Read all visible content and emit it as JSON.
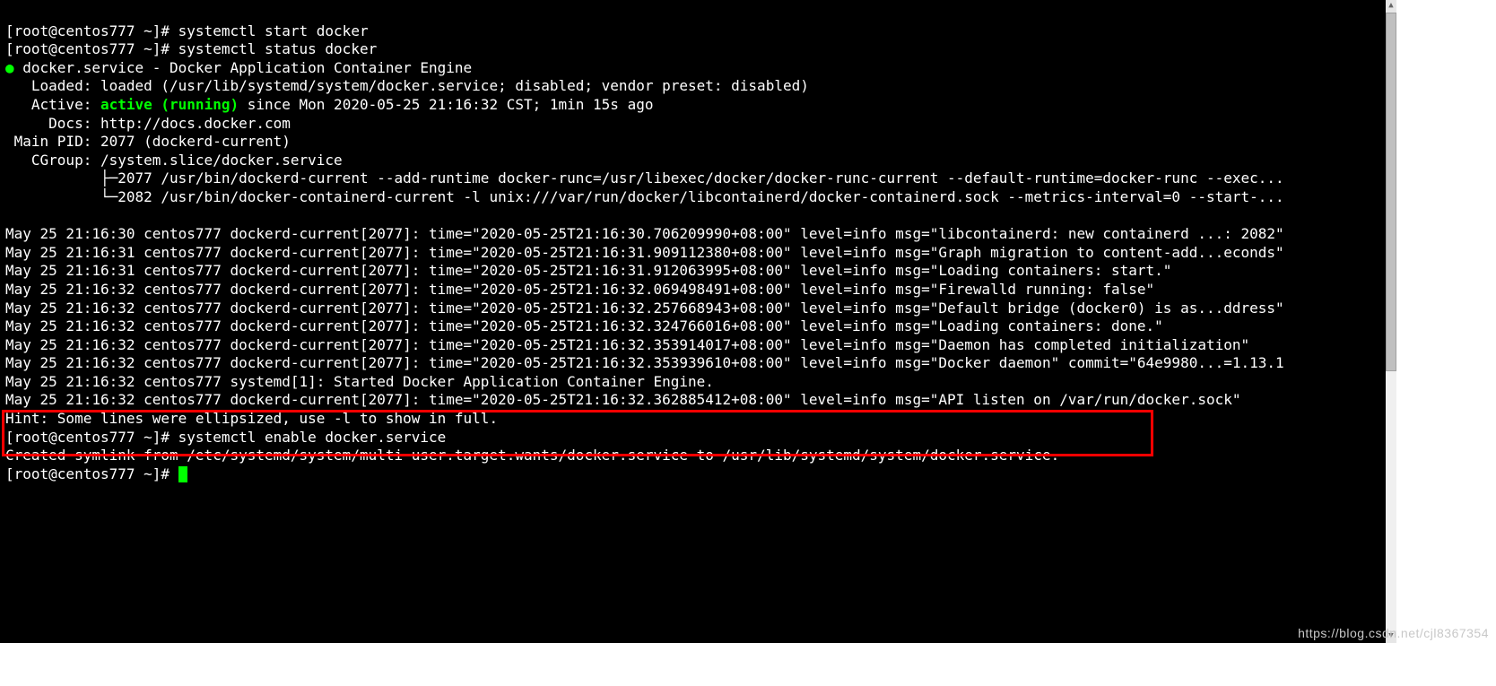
{
  "prompt": "[root@centos777 ~]# ",
  "cmd": {
    "start": "systemctl start docker",
    "status": "systemctl status docker",
    "enable": "systemctl enable docker.service"
  },
  "status": {
    "head": "docker.service - Docker Application Container Engine",
    "loaded": "   Loaded: loaded (/usr/lib/systemd/system/docker.service; disabled; vendor preset: disabled)",
    "active_l": "   Active: ",
    "active_v": "active (running)",
    "active_r": " since Mon 2020-05-25 21:16:32 CST; 1min 15s ago",
    "docs": "     Docs: http://docs.docker.com",
    "mainpid": " Main PID: 2077 (dockerd-current)",
    "cgroup": "   CGroup: /system.slice/docker.service",
    "proc1": "           ├─2077 /usr/bin/dockerd-current --add-runtime docker-runc=/usr/libexec/docker/docker-runc-current --default-runtime=docker-runc --exec...",
    "proc2": "           └─2082 /usr/bin/docker-containerd-current -l unix:///var/run/docker/libcontainerd/docker-containerd.sock --metrics-interval=0 --start-..."
  },
  "logs": [
    "May 25 21:16:30 centos777 dockerd-current[2077]: time=\"2020-05-25T21:16:30.706209990+08:00\" level=info msg=\"libcontainerd: new containerd ...: 2082\"",
    "May 25 21:16:31 centos777 dockerd-current[2077]: time=\"2020-05-25T21:16:31.909112380+08:00\" level=info msg=\"Graph migration to content-add...econds\"",
    "May 25 21:16:31 centos777 dockerd-current[2077]: time=\"2020-05-25T21:16:31.912063995+08:00\" level=info msg=\"Loading containers: start.\"",
    "May 25 21:16:32 centos777 dockerd-current[2077]: time=\"2020-05-25T21:16:32.069498491+08:00\" level=info msg=\"Firewalld running: false\"",
    "May 25 21:16:32 centos777 dockerd-current[2077]: time=\"2020-05-25T21:16:32.257668943+08:00\" level=info msg=\"Default bridge (docker0) is as...ddress\"",
    "May 25 21:16:32 centos777 dockerd-current[2077]: time=\"2020-05-25T21:16:32.324766016+08:00\" level=info msg=\"Loading containers: done.\"",
    "May 25 21:16:32 centos777 dockerd-current[2077]: time=\"2020-05-25T21:16:32.353914017+08:00\" level=info msg=\"Daemon has completed initialization\"",
    "May 25 21:16:32 centos777 dockerd-current[2077]: time=\"2020-05-25T21:16:32.353939610+08:00\" level=info msg=\"Docker daemon\" commit=\"64e9980...=1.13.1",
    "May 25 21:16:32 centos777 systemd[1]: Started Docker Application Container Engine.",
    "May 25 21:16:32 centos777 dockerd-current[2077]: time=\"2020-05-25T21:16:32.362885412+08:00\" level=info msg=\"API listen on /var/run/docker.sock\""
  ],
  "hint": "Hint: Some lines were ellipsized, use -l to show in full.",
  "enable_out": "Created symlink from /etc/systemd/system/multi-user.target.wants/docker.service to /usr/lib/systemd/system/docker.service.",
  "watermark": "https://blog.csdn.net/cjl8367354",
  "scroll": {
    "up_glyph": "▲",
    "down_glyph": "▼"
  }
}
